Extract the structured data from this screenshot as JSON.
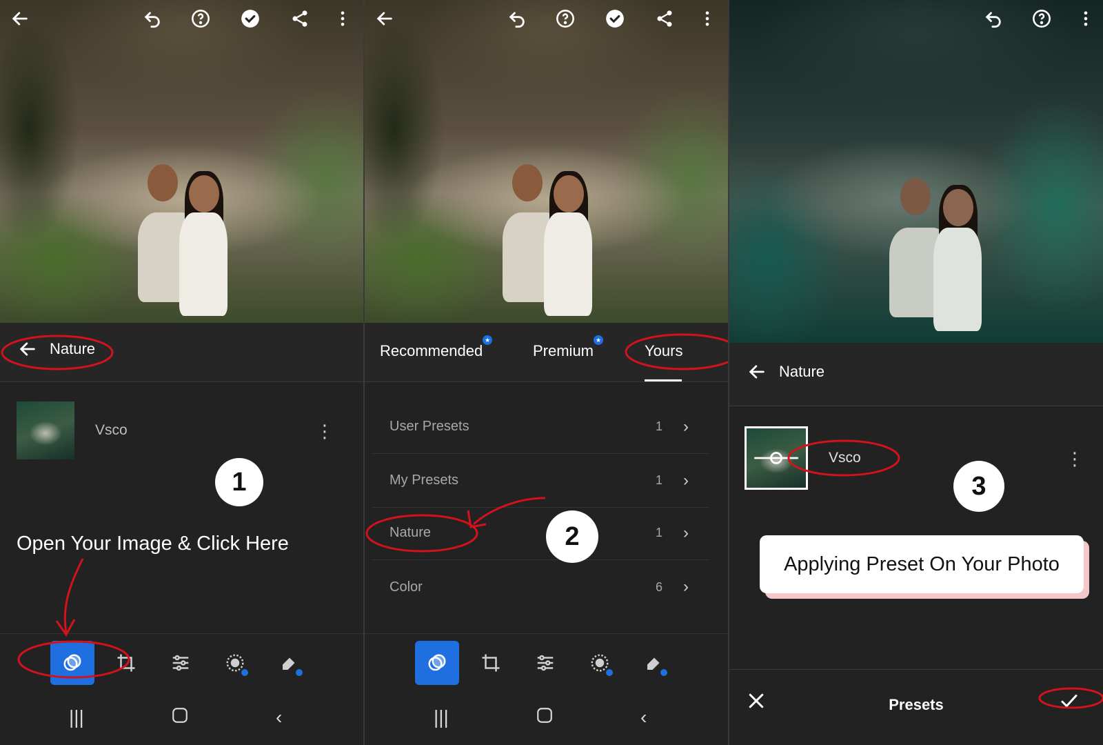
{
  "panel1": {
    "header": {
      "back_label": "Nature"
    },
    "preset": {
      "name": "Vsco"
    },
    "step_number": "1",
    "instruction": "Open Your Image & Click Here"
  },
  "panel2": {
    "tabs": [
      {
        "label": "Recommended",
        "has_badge": true
      },
      {
        "label": "Premium",
        "has_badge": true
      },
      {
        "label": "Yours",
        "active": true
      }
    ],
    "folders": [
      {
        "name": "User Presets",
        "count": "1"
      },
      {
        "name": "My Presets",
        "count": "1"
      },
      {
        "name": "Nature",
        "count": "1"
      },
      {
        "name": "Color",
        "count": "6"
      }
    ],
    "step_number": "2"
  },
  "panel3": {
    "header": {
      "back_label": "Nature"
    },
    "preset": {
      "name": "Vsco"
    },
    "step_number": "3",
    "callout": "Applying Preset On Your Photo",
    "bottom_title": "Presets"
  },
  "colors": {
    "accent_blue": "#1f6fe0",
    "annotation_red": "#d3121c",
    "background": "#222222"
  },
  "icons": [
    "back-arrow-icon",
    "undo-icon",
    "help-icon",
    "check-circle-icon",
    "share-icon",
    "more-vert-icon",
    "presets-icon",
    "crop-icon",
    "adjust-sliders-icon",
    "masking-icon",
    "healing-icon",
    "close-icon",
    "checkmark-icon",
    "chevron-right-icon"
  ]
}
